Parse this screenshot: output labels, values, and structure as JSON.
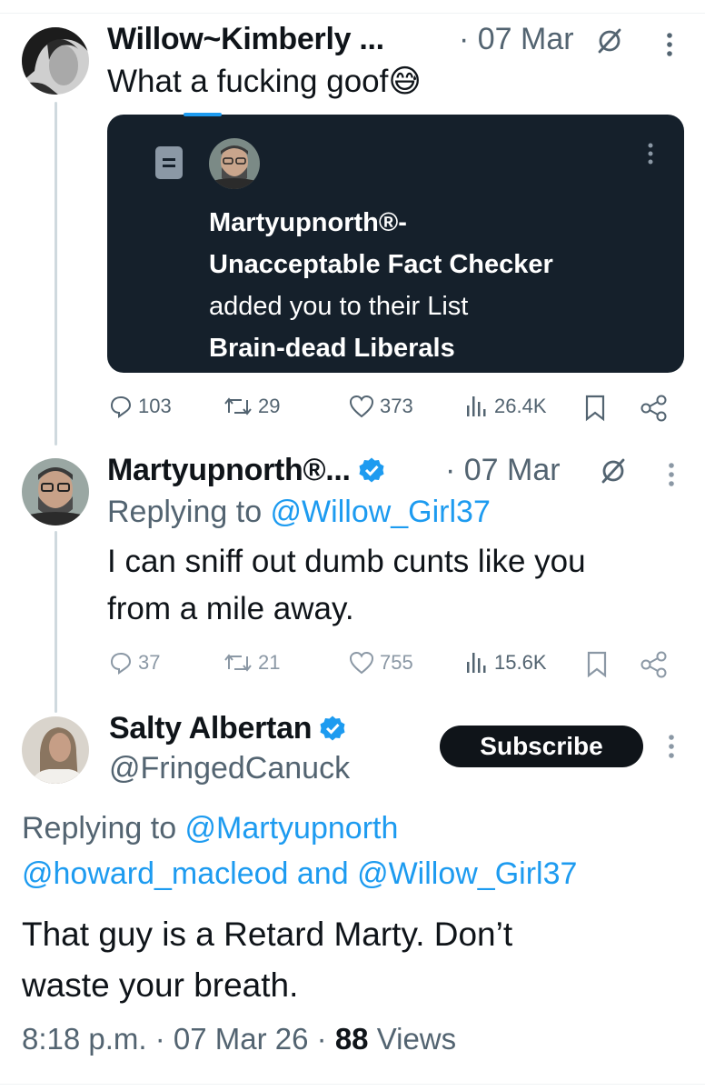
{
  "tweet1": {
    "name": "Willow~Kimberly ...",
    "date": "· 07 Mar",
    "text": "What a fucking goof",
    "emoji": "😅",
    "card": {
      "line1": "Martyupnorth®-",
      "line2": "Unacceptable Fact Checker",
      "line3": "added you to their List",
      "line4": "Brain-dead Liberals"
    },
    "stats": {
      "replies": "103",
      "retweets": "29",
      "likes": "373",
      "views": "26.4K"
    }
  },
  "tweet2": {
    "name": "Martyupnorth®...",
    "date": "· 07 Mar",
    "replying_prefix": "Replying to ",
    "replying_handle": "@Willow_Girl37",
    "text_line1": "I can sniff out dumb cunts like you",
    "text_line2": "from a mile away.",
    "stats": {
      "replies": "37",
      "retweets": "21",
      "likes": "755",
      "views": "15.6K"
    }
  },
  "tweet3": {
    "name": "Salty Albertan",
    "handle": "@FringedCanuck",
    "subscribe_label": "Subscribe",
    "replying_prefix": "Replying to ",
    "replying_handle1": "@Martyupnorth",
    "replying_handle2": "@howard_macleod",
    "replying_and": " and ",
    "replying_handle3": "@Willow_Girl37",
    "text_line1": "That guy is a Retard Marty. Don’t",
    "text_line2": "waste your breath.",
    "time": "8:18 p.m. · 07 Mar 26 · ",
    "views_count": "88",
    "views_label": " Views"
  },
  "colors": {
    "accent": "#1d9bf0",
    "card_bg": "#15202b",
    "text": "#0f1419",
    "muted": "#536471"
  }
}
